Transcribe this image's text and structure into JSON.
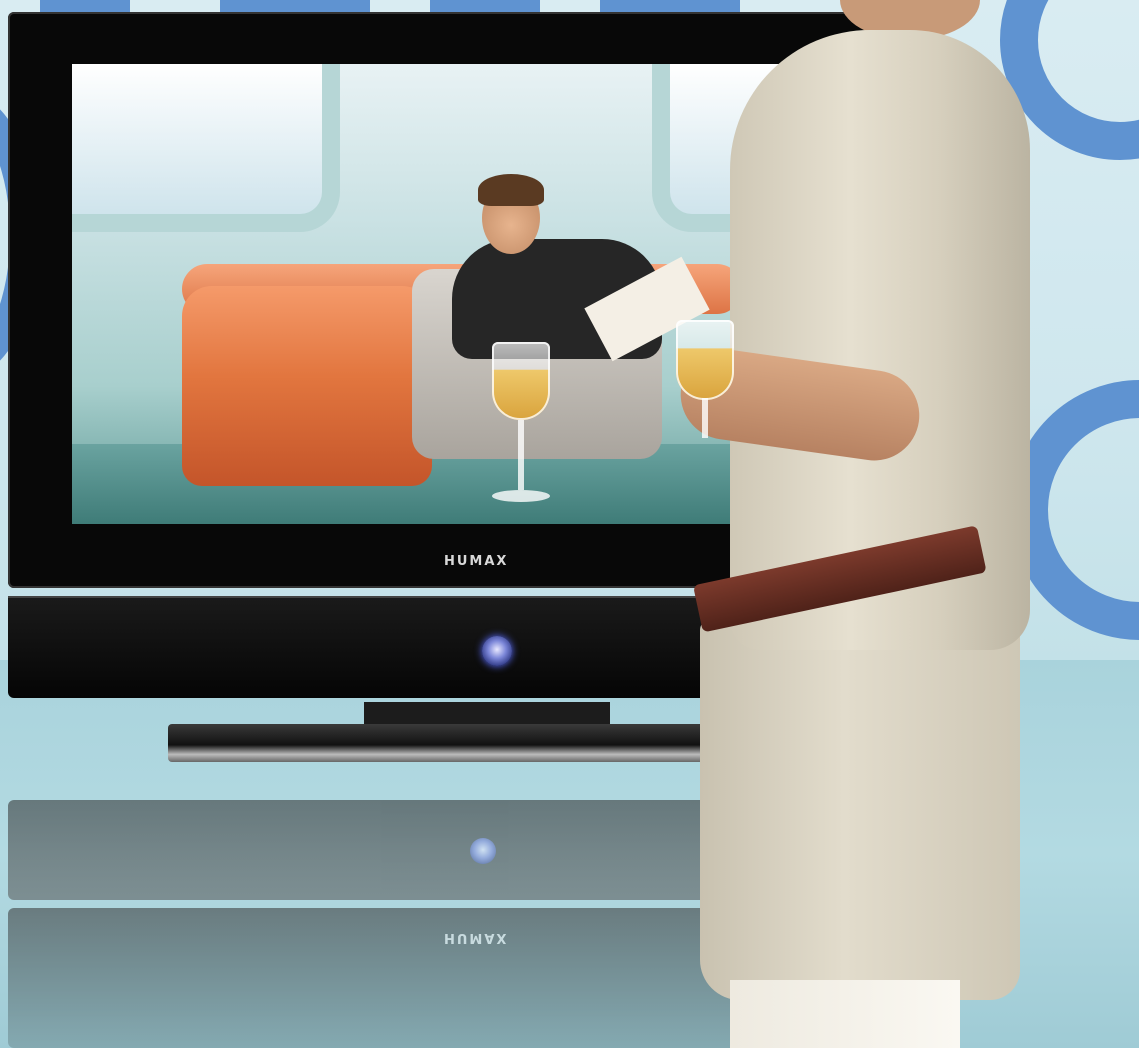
{
  "tv": {
    "brand_label": "HUMAX",
    "reflection_brand_label": "HUMAX"
  },
  "colors": {
    "accent_blue": "#5f93d1",
    "wall": "#d9ecf2",
    "floor": "#aed6de",
    "bezel": "#080808",
    "sofa_orange": "#e2763f",
    "belt_brown": "#6a2e22"
  },
  "icons": {
    "power": "power-button-icon"
  }
}
